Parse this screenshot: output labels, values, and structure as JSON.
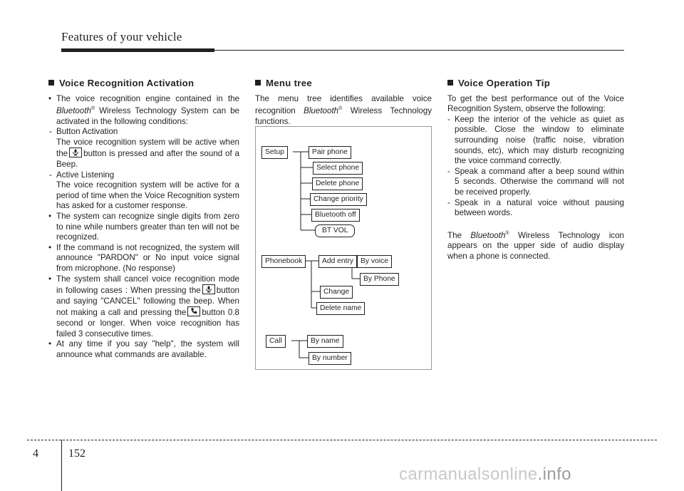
{
  "header": {
    "title": "Features of your vehicle"
  },
  "footer": {
    "chapter": "4",
    "page": "152",
    "watermark_1": "carmanualsonline",
    "watermark_2": ".info"
  },
  "col1": {
    "heading": "Voice Recognition Activation",
    "b1": "The voice recognition engine contained in the",
    "b1_italic": "Bluetooth",
    "b1_sup": "®",
    "b1_cont": "Wireless Technology System can be activated in the following conditions:",
    "d1_title": "Button Activation",
    "d1_text_a": "The voice recognition system will be active when the",
    "d1_text_b": "button is pressed and after the sound of a Beep.",
    "d2_title": "Active Listening",
    "d2_text": "The voice recognition system will be active for a period of time when the Voice Recognition system has asked for a customer response.",
    "b2": "The system can recognize single digits from zero to nine while numbers greater than ten will not be recognized.",
    "b3": "If the command is not recognized, the system will announce \"PARDON\" or No input voice signal from microphone. (No response)",
    "b4_a": "The system shall cancel voice recognition mode in following cases : When pressing the",
    "b4_b": "button and saying \"CANCEL\" following the beep. When not making a call and pressing the",
    "b4_c": "button 0.8 second or longer. When voice recognition has failed 3 consecutive times.",
    "b5": "At any time if you say \"help\", the system will announce what commands are available."
  },
  "col2": {
    "heading": "Menu tree",
    "p1_a": "The menu tree identifies available voice recognition",
    "p1_italic": "Bluetooth",
    "p1_sup": "®",
    "p1_b": "Wireless Technology functions.",
    "tree": {
      "setup": "Setup",
      "setup_children": [
        "Pair phone",
        "Select phone",
        "Delete phone",
        "Change priority",
        "Bluetooth off",
        "BT VOL"
      ],
      "phonebook": "Phonebook",
      "add_entry": "Add entry",
      "add_entry_children": [
        "By voice",
        "By Phone"
      ],
      "change": "Change",
      "delete_name": "Delete name",
      "call": "Call",
      "call_children": [
        "By name",
        "By number"
      ]
    }
  },
  "col3": {
    "heading": "Voice Operation Tip",
    "p1": "To get the best performance out of the Voice Recognition System, observe the following:",
    "d1": "Keep the interior of the vehicle as quiet as possible. Close the window to eliminate surrounding noise (traffic noise, vibration sounds, etc), which may disturb recognizing the voice command correctly.",
    "d2": "Speak a command after a beep sound within 5 seconds. Otherwise the command will not be received properly.",
    "d3": "Speak in a natural voice without pausing between words.",
    "p2_a": "The",
    "p2_italic": "Bluetooth",
    "p2_sup": "®",
    "p2_b": "Wireless Technology icon appears on the upper side of audio display when a phone is connected."
  }
}
